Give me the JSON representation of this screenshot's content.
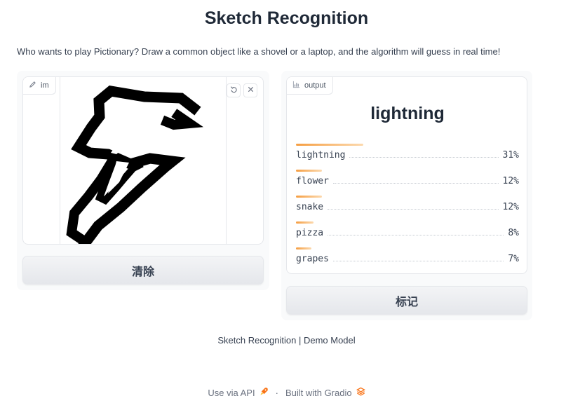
{
  "app": {
    "title": "Sketch Recognition",
    "description": "Who wants to play Pictionary? Draw a common object like a shovel or a laptop, and the algorithm will guess in real time!"
  },
  "input_panel": {
    "label": "im",
    "label_icon": "pencil-icon",
    "undo_icon": "undo-icon",
    "clear_icon": "close-icon",
    "clear_button": "清除"
  },
  "output_panel": {
    "label": "output",
    "label_icon": "bar-chart-icon",
    "top_label": "lightning",
    "bar_color": "#f59e42",
    "confidences": [
      {
        "label": "lightning",
        "value_text": "31%",
        "value": 0.31
      },
      {
        "label": "flower",
        "value_text": "12%",
        "value": 0.12
      },
      {
        "label": "snake",
        "value_text": "12%",
        "value": 0.12
      },
      {
        "label": "pizza",
        "value_text": "8%",
        "value": 0.08
      },
      {
        "label": "grapes",
        "value_text": "7%",
        "value": 0.07
      }
    ],
    "flag_button": "标记"
  },
  "footer": {
    "note": "Sketch Recognition | Demo Model",
    "api_link": "Use via API",
    "api_icon": "rocket-icon",
    "separator": "·",
    "built_with": "Built with Gradio",
    "gradio_icon": "gradio-logo-icon",
    "accent_color": "#f97316"
  }
}
